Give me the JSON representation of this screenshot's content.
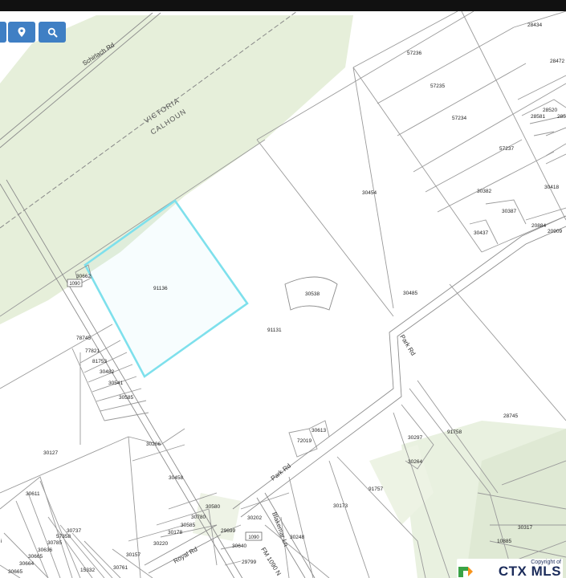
{
  "controls": {
    "buttons": [
      {
        "name": "layers-button",
        "icon": "square-icon"
      },
      {
        "name": "location-button",
        "icon": "map-pin-icon"
      },
      {
        "name": "search-button",
        "icon": "search-icon"
      }
    ],
    "accent_color": "#3f7fc4"
  },
  "map": {
    "county_labels": [
      "VICTORIA",
      "CALHOUN"
    ],
    "roads": [
      {
        "id": "schirlach",
        "label": "Schirlach Rd"
      },
      {
        "id": "park1",
        "label": "Park Rd"
      },
      {
        "id": "park2",
        "label": "Park Rd"
      },
      {
        "id": "royal",
        "label": "Royal Rd"
      },
      {
        "id": "blakemar",
        "label": "Blakemar Ln"
      },
      {
        "id": "fm1090",
        "label": "FM 1090 N"
      }
    ],
    "highway_shields": [
      "1090",
      "1090"
    ],
    "highlighted_parcel": "91136",
    "highlight_color": "#7ee0ec",
    "parcels": [
      "28434",
      "28472",
      "57236",
      "57235",
      "57234",
      "57237",
      "28520",
      "28581",
      "285",
      "30454",
      "30382",
      "30418",
      "30387",
      "30437",
      "20884",
      "20909",
      "30662",
      "91136",
      "30538",
      "91131",
      "30485",
      "78745",
      "77821",
      "81753",
      "30482",
      "30541",
      "30585",
      "30613",
      "72019",
      "30297",
      "91758",
      "28745",
      "30264",
      "30206",
      "30127",
      "30458",
      "91757",
      "30173",
      "30580",
      "30780",
      "30585",
      "30611",
      "30737",
      "57358",
      "30785",
      "30636",
      "30665",
      "30664",
      "30665",
      "15332",
      "30761",
      "30157",
      "30178",
      "30220",
      "29699",
      "30202",
      "30248",
      "30640",
      "29799",
      "30317",
      "10885",
      "i"
    ]
  },
  "attribution": {
    "line1": "Copyright of",
    "brand": "CTX MLS"
  }
}
